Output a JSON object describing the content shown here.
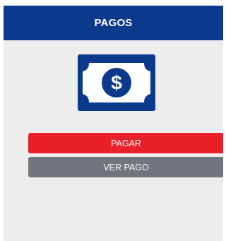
{
  "header": {
    "title": "PAGOS"
  },
  "icon": {
    "name": "money-bill-dollar-icon",
    "symbol": "$"
  },
  "actions": {
    "pay_label": "PAGAR",
    "view_label": "VER PAGO"
  },
  "colors": {
    "header_bg": "#0b3a8c",
    "icon": "#0b3a8c",
    "pay_button": "#e8202a",
    "view_button": "#70767c",
    "background": "#ededed"
  }
}
